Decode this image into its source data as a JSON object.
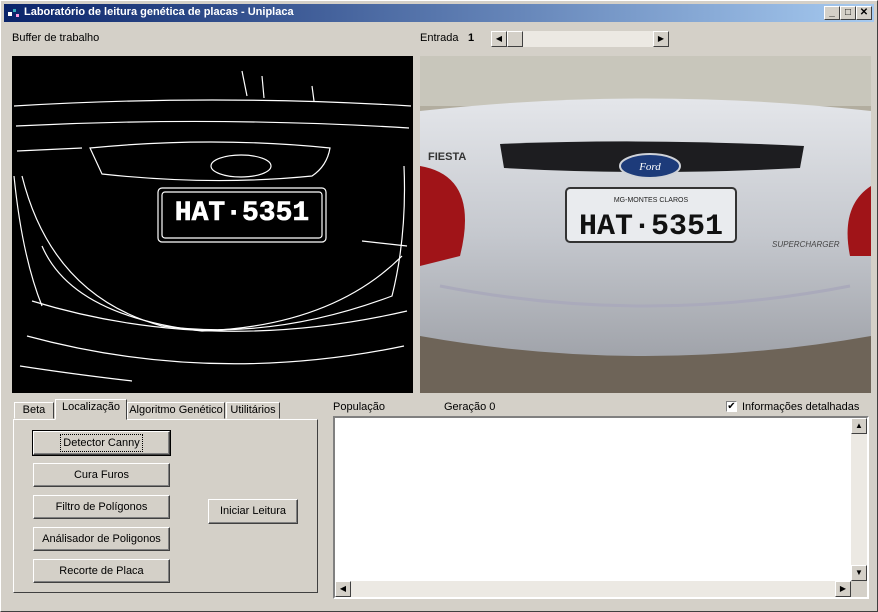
{
  "window": {
    "title": "Laboratório de leitura genética de placas - Uniplaca"
  },
  "buffer": {
    "label": "Buffer de trabalho"
  },
  "entrada": {
    "label": "Entrada",
    "value": "1"
  },
  "plate": {
    "text": "HAT·5351",
    "city": "MG-MONTES CLAROS",
    "brand": "Ford",
    "model": "FIESTA",
    "badge": "SUPERCHARGER"
  },
  "tabs": [
    "Beta",
    "Localização",
    "Algoritmo Genético",
    "Utilitários"
  ],
  "buttons": {
    "canny": "Detector Canny",
    "cura": "Cura Furos",
    "filtro": "Filtro de Polígonos",
    "analisador": "Análisador de Poligonos",
    "recorte": "Recorte de Placa",
    "iniciar": "Iniciar Leitura"
  },
  "population": {
    "label": "População",
    "generation": "Geração 0"
  },
  "details": {
    "label": "Informações detalhadas",
    "checked": true
  }
}
